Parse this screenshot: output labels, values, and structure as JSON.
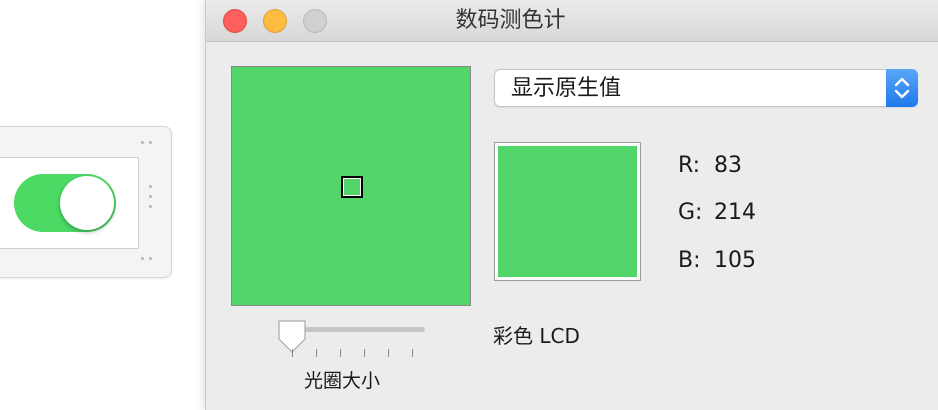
{
  "background_app": {
    "toggle_state": "on",
    "toggle_color": "#4cd964"
  },
  "window": {
    "title": "数码测色计",
    "display_mode": "显示原生值",
    "sampled_color": "#53d669",
    "readout": {
      "r_label": "R:",
      "r_value": "83",
      "g_label": "G:",
      "g_value": "214",
      "b_label": "B:",
      "b_value": "105"
    },
    "color_profile": "彩色 LCD",
    "aperture_slider": {
      "label": "光圈大小",
      "level": 0
    }
  },
  "icons": [
    "close-icon",
    "minimize-icon",
    "zoom-icon",
    "chevron-updown-icon"
  ]
}
